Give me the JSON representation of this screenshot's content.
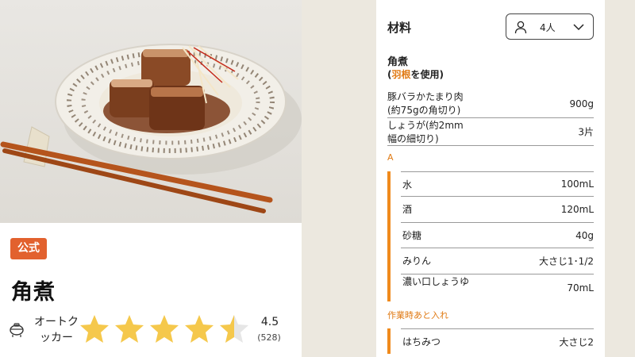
{
  "recipe": {
    "badge": "公式",
    "title": "角煮",
    "device": "オートクッカー",
    "rating": "4.5",
    "rating_count": "(528)",
    "rating_value": 4.5
  },
  "ingredients": {
    "title": "材料",
    "servings": "4人",
    "section": "角煮",
    "note_prefix": "(",
    "note_highlight": "羽根",
    "note_suffix": "を使用)",
    "items": [
      {
        "name": "豚バラかたまり肉(約75gの角切り)",
        "qty": "900g"
      },
      {
        "name": "しょうが(約2mm幅の細切り)",
        "qty": "3片"
      }
    ],
    "group_a": {
      "label": "A",
      "items": [
        {
          "name": "水",
          "qty": "100mL"
        },
        {
          "name": "酒",
          "qty": "120mL"
        },
        {
          "name": "砂糖",
          "qty": "40g"
        },
        {
          "name": "みりん",
          "qty": "大さじ1･1/2"
        },
        {
          "name": "濃い口しょうゆ",
          "qty": "70mL"
        }
      ]
    },
    "group_b": {
      "label": "作業時あと入れ",
      "items": [
        {
          "name": "はちみつ",
          "qty": "大さじ2"
        }
      ]
    }
  },
  "colors": {
    "accent": "#e2612e",
    "orange": "#f08a1c",
    "star": "#f5c84c"
  },
  "icons": [
    "auto-cooker-icon",
    "star-icon",
    "person-icon",
    "chevron-down-icon"
  ]
}
